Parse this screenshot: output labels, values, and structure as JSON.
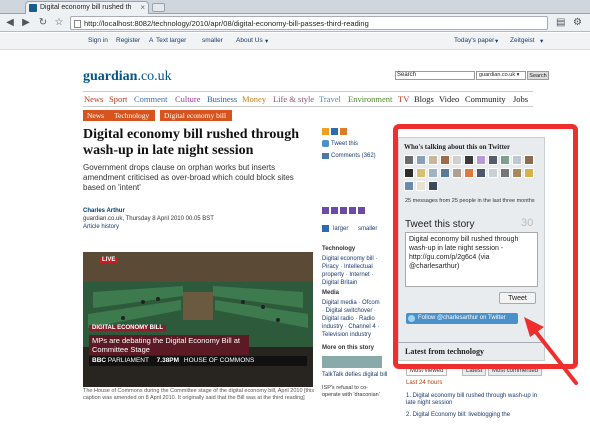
{
  "browser": {
    "tab_title": "Digital economy bill rushed th",
    "url": "http://localhost:8082/technology/2010/apr/08/digital-economy-bill-passes-third-reading"
  },
  "topbar": {
    "sign_in": "Sign in",
    "register": "Register",
    "text_larger": "Text larger",
    "smaller": "smaller",
    "about_us": "About Us",
    "todays_paper": "Today's paper",
    "zeitgeist": "Zeitgeist"
  },
  "masthead": {
    "logo_main": "guardian",
    "logo_tld": ".co.uk",
    "search_value": "Search",
    "search_scope": "guardian.co.uk",
    "search_button": "Search"
  },
  "nav": [
    "News",
    "Sport",
    "Comment",
    "Culture",
    "Business",
    "Money",
    "Life & style",
    "Travel",
    "Environment",
    "TV",
    "Blogs",
    "Video",
    "Community",
    "Jobs"
  ],
  "breadcrumbs": [
    "News",
    "Technology",
    "Digital economy bill"
  ],
  "article": {
    "headline": "Digital economy bill rushed through wash-up in late night session",
    "standfirst": "Government drops clause on orphan works but inserts amendment criticised as over-broad which could block sites based on 'intent'",
    "author": "Charles Arthur",
    "byline": "guardian.co.uk, Thursday 8 April 2010 00.05 BST",
    "history": "Article history",
    "photo": {
      "live": "LIVE",
      "lower_tag": "DIGITAL ECONOMY BILL",
      "lower_text": "MPs are debating the Digital Economy Bill at Committee Stage",
      "bbc": "BBC",
      "channel": "PARLIAMENT",
      "time": "7.38PM",
      "house": "HOUSE OF COMMONS"
    },
    "caption": "The House of Commons during the Committee stage of the digital economy bill, April 2010 [this caption was amended on 8 April 2010. It originally said that the Bill was at the third reading]"
  },
  "middle": {
    "tweet_this": "Tweet this",
    "comments": "Comments (362)",
    "larger": "larger",
    "smaller": "smaller",
    "technology_heading": "Technology",
    "technology_links": "Digital economy bill · Piracy · Intellectual property · Internet · Digital Britain",
    "media_heading": "Media",
    "media_links": "Digital media · Ofcom · Digital switchover · Digital radio · Radio industry · Channel 4 · Television industry",
    "more_heading": "More on this story",
    "story_title": "TalkTalk defies digital bill",
    "story_text": "ISP's refusal to co-operate with 'draconian'"
  },
  "twitter": {
    "title": "Who's talking about this on Twitter",
    "message_count": "25 messages from 25 people in the last three months",
    "tweet_title": "Tweet this story",
    "char_count": "30",
    "tweet_text": "Digital economy bill rushed through wash-up in late night session - http://gu.com/p/2g6c4 (via @charlesarthur)",
    "tweet_button": "Tweet",
    "follow_button": "Follow @charlesarthur on Twitter",
    "avatar_colors": [
      "#6b6b6b",
      "#8aa0b8",
      "#c9b79c",
      "#a36a4a",
      "#d0d0d0",
      "#3a3a3a",
      "#b99ad6",
      "#555e6b",
      "#7fa08a",
      "#c0c8cf",
      "#8c6d4f",
      "#2c2c2c",
      "#d8c070",
      "#9fb3c7",
      "#5a7a9a",
      "#b0a090",
      "#e07a3a",
      "#4a5a6a",
      "#c8d0d8",
      "#777777",
      "#a88a5a",
      "#d6b24a",
      "#6a8ab0",
      "#e8e0d0",
      "#3b4a5c"
    ]
  },
  "latest": {
    "heading": "Latest from technology",
    "tabs": [
      "Most viewed",
      "Latest",
      "Most commented"
    ],
    "last24": "Last 24 hours",
    "items": [
      "1. Digital economy bill rushed through wash-up in late night session",
      "2. Digital Economy bill: liveblogging the"
    ]
  },
  "colors": {
    "highlight_frame": "#ef2e2e",
    "brand_blue": "#005689",
    "crumb_orange": "#d8541e",
    "twitter_blue": "#4a90c9"
  }
}
